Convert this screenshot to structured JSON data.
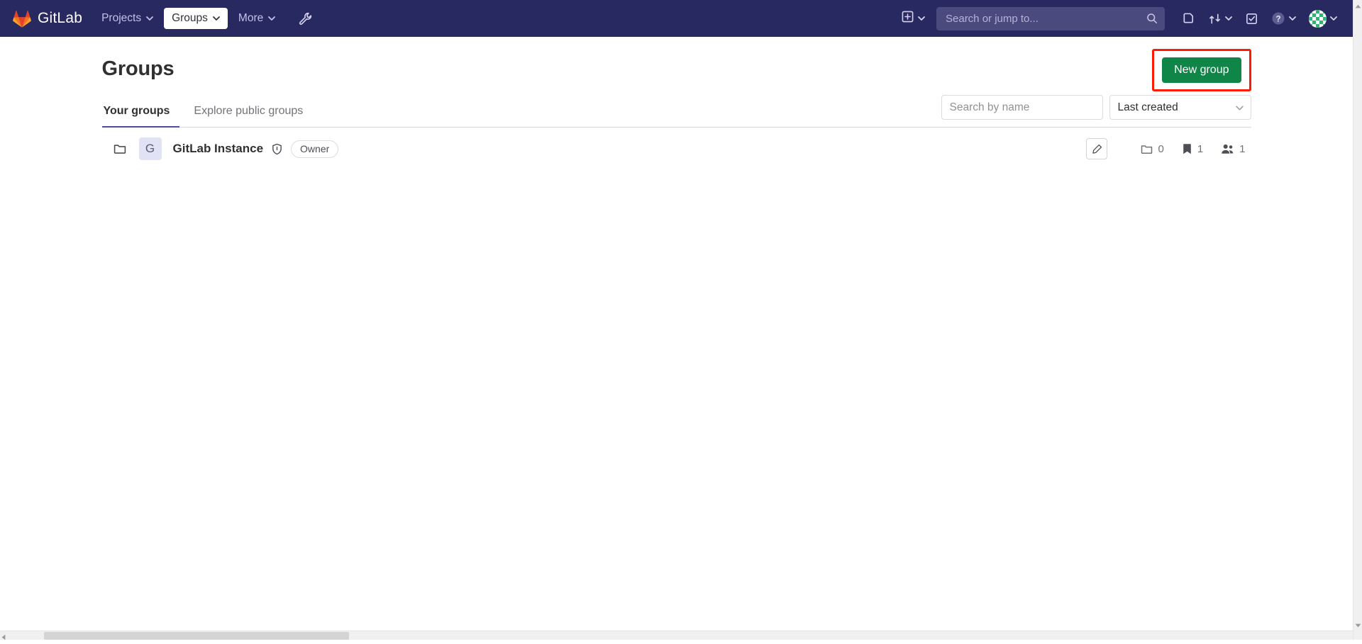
{
  "navbar": {
    "brand": {
      "name": "GitLab",
      "logo_icon": "gitlab-tanuki-logo"
    },
    "items": [
      {
        "label": "Projects",
        "icon": "chevron-down-icon",
        "active": false
      },
      {
        "label": "Groups",
        "icon": "chevron-down-icon",
        "active": true
      },
      {
        "label": "More",
        "icon": "chevron-down-icon",
        "active": false
      }
    ],
    "tool_icon": "wrench-icon",
    "create_new_icon": "plus-square-icon",
    "create_new_caret": "chevron-down-icon",
    "search": {
      "placeholder": "Search or jump to...",
      "value": "",
      "icon": "search-icon"
    },
    "right_icons": [
      {
        "name": "issues-icon",
        "label": ""
      },
      {
        "name": "merge-requests-icon",
        "label": ""
      },
      {
        "name": "todos-icon",
        "label": ""
      },
      {
        "name": "help-icon",
        "label": ""
      }
    ],
    "avatar": {
      "name": "user-avatar-identicon",
      "caret": "chevron-down-icon"
    },
    "bg_color": "#292961",
    "search_bg_color": "#4a4a7f"
  },
  "page": {
    "title": "Groups",
    "new_group_button": {
      "label": "New group",
      "color": "#108548",
      "highlight_color": "#fc1c03"
    },
    "tabs": [
      {
        "label": "Your groups",
        "active": true
      },
      {
        "label": "Explore public groups",
        "active": false
      }
    ],
    "filters": {
      "search": {
        "placeholder": "Search by name",
        "value": ""
      },
      "sort": {
        "value": "Last created",
        "caret": "chevron-down-icon"
      }
    },
    "groups": [
      {
        "folder_icon": "folder-icon",
        "avatar_initial": "G",
        "name": "GitLab Instance",
        "visibility_icon": "shield-icon",
        "role_badge": "Owner",
        "edit_icon": "pencil-icon",
        "stats": [
          {
            "icon": "subgroups-folder-icon",
            "value": "0"
          },
          {
            "icon": "projects-bookmark-icon",
            "value": "1"
          },
          {
            "icon": "members-users-icon",
            "value": "1"
          }
        ]
      }
    ]
  },
  "scrollbars": {
    "vertical_up_icon": "scroll-up-arrow",
    "vertical_down_icon": "scroll-down-arrow",
    "horizontal_left_icon": "scroll-left-arrow"
  }
}
